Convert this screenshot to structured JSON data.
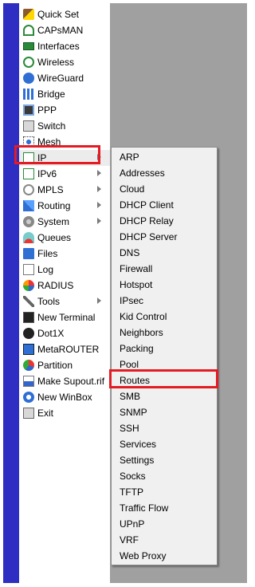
{
  "main_menu": {
    "items": [
      {
        "label": "Quick Set",
        "icon": "quick-set-wand-icon",
        "submenu": false
      },
      {
        "label": "CAPsMAN",
        "icon": "capsman-antenna-icon",
        "submenu": false
      },
      {
        "label": "Interfaces",
        "icon": "interfaces-card-icon",
        "submenu": false
      },
      {
        "label": "Wireless",
        "icon": "wireless-antenna-icon",
        "submenu": false
      },
      {
        "label": "WireGuard",
        "icon": "wireguard-icon",
        "submenu": false
      },
      {
        "label": "Bridge",
        "icon": "bridge-icon",
        "submenu": false
      },
      {
        "label": "PPP",
        "icon": "ppp-icon",
        "submenu": false
      },
      {
        "label": "Switch",
        "icon": "switch-icon",
        "submenu": false
      },
      {
        "label": "Mesh",
        "icon": "mesh-icon",
        "submenu": false
      },
      {
        "label": "IP",
        "icon": "ip-icon",
        "submenu": true,
        "active": true
      },
      {
        "label": "IPv6",
        "icon": "ipv6-icon",
        "submenu": true
      },
      {
        "label": "MPLS",
        "icon": "mpls-icon",
        "submenu": true
      },
      {
        "label": "Routing",
        "icon": "routing-icon",
        "submenu": true
      },
      {
        "label": "System",
        "icon": "system-gear-icon",
        "submenu": true
      },
      {
        "label": "Queues",
        "icon": "queues-icon",
        "submenu": false
      },
      {
        "label": "Files",
        "icon": "files-folder-icon",
        "submenu": false
      },
      {
        "label": "Log",
        "icon": "log-icon",
        "submenu": false
      },
      {
        "label": "RADIUS",
        "icon": "radius-icon",
        "submenu": false
      },
      {
        "label": "Tools",
        "icon": "tools-icon",
        "submenu": true
      },
      {
        "label": "New Terminal",
        "icon": "terminal-icon",
        "submenu": false
      },
      {
        "label": "Dot1X",
        "icon": "dot1x-icon",
        "submenu": false
      },
      {
        "label": "MetaROUTER",
        "icon": "metarouter-icon",
        "submenu": false
      },
      {
        "label": "Partition",
        "icon": "partition-icon",
        "submenu": false
      },
      {
        "label": "Make Supout.rif",
        "icon": "supout-icon",
        "submenu": false
      },
      {
        "label": "New WinBox",
        "icon": "winbox-icon",
        "submenu": false
      },
      {
        "label": "Exit",
        "icon": "exit-icon",
        "submenu": false
      }
    ]
  },
  "ip_submenu": {
    "items": [
      "ARP",
      "Addresses",
      "Cloud",
      "DHCP Client",
      "DHCP Relay",
      "DHCP Server",
      "DNS",
      "Firewall",
      "Hotspot",
      "IPsec",
      "Kid Control",
      "Neighbors",
      "Packing",
      "Pool",
      "Routes",
      "SMB",
      "SNMP",
      "SSH",
      "Services",
      "Settings",
      "Socks",
      "TFTP",
      "Traffic Flow",
      "UPnP",
      "VRF",
      "Web Proxy"
    ],
    "highlighted": "Routes"
  },
  "colors": {
    "side_bar": "#2e2ec2",
    "content_area": "#a0a0a0",
    "highlight_box": "#e31b23",
    "submenu_bg": "#f0f0f0"
  }
}
